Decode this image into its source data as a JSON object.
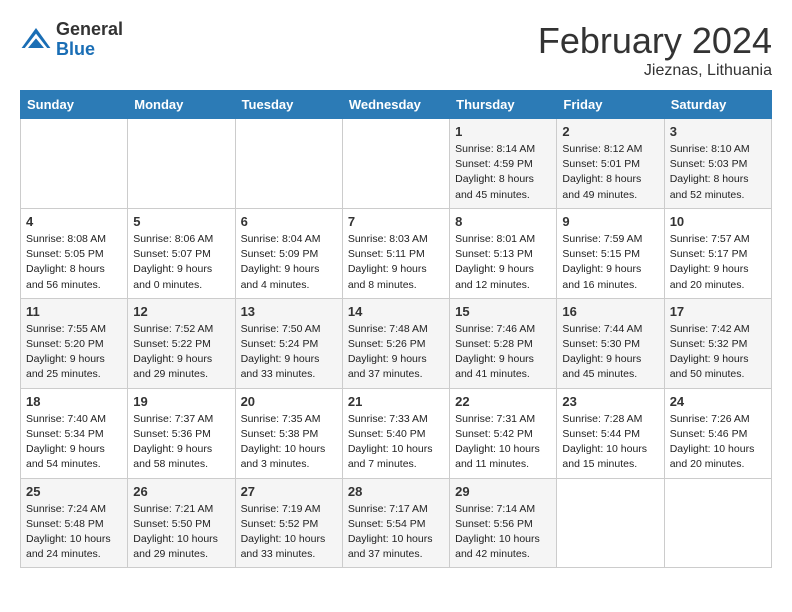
{
  "header": {
    "logo_general": "General",
    "logo_blue": "Blue",
    "month_title": "February 2024",
    "location": "Jieznas, Lithuania"
  },
  "weekdays": [
    "Sunday",
    "Monday",
    "Tuesday",
    "Wednesday",
    "Thursday",
    "Friday",
    "Saturday"
  ],
  "weeks": [
    [
      {
        "day": "",
        "info": ""
      },
      {
        "day": "",
        "info": ""
      },
      {
        "day": "",
        "info": ""
      },
      {
        "day": "",
        "info": ""
      },
      {
        "day": "1",
        "info": "Sunrise: 8:14 AM\nSunset: 4:59 PM\nDaylight: 8 hours\nand 45 minutes."
      },
      {
        "day": "2",
        "info": "Sunrise: 8:12 AM\nSunset: 5:01 PM\nDaylight: 8 hours\nand 49 minutes."
      },
      {
        "day": "3",
        "info": "Sunrise: 8:10 AM\nSunset: 5:03 PM\nDaylight: 8 hours\nand 52 minutes."
      }
    ],
    [
      {
        "day": "4",
        "info": "Sunrise: 8:08 AM\nSunset: 5:05 PM\nDaylight: 8 hours\nand 56 minutes."
      },
      {
        "day": "5",
        "info": "Sunrise: 8:06 AM\nSunset: 5:07 PM\nDaylight: 9 hours\nand 0 minutes."
      },
      {
        "day": "6",
        "info": "Sunrise: 8:04 AM\nSunset: 5:09 PM\nDaylight: 9 hours\nand 4 minutes."
      },
      {
        "day": "7",
        "info": "Sunrise: 8:03 AM\nSunset: 5:11 PM\nDaylight: 9 hours\nand 8 minutes."
      },
      {
        "day": "8",
        "info": "Sunrise: 8:01 AM\nSunset: 5:13 PM\nDaylight: 9 hours\nand 12 minutes."
      },
      {
        "day": "9",
        "info": "Sunrise: 7:59 AM\nSunset: 5:15 PM\nDaylight: 9 hours\nand 16 minutes."
      },
      {
        "day": "10",
        "info": "Sunrise: 7:57 AM\nSunset: 5:17 PM\nDaylight: 9 hours\nand 20 minutes."
      }
    ],
    [
      {
        "day": "11",
        "info": "Sunrise: 7:55 AM\nSunset: 5:20 PM\nDaylight: 9 hours\nand 25 minutes."
      },
      {
        "day": "12",
        "info": "Sunrise: 7:52 AM\nSunset: 5:22 PM\nDaylight: 9 hours\nand 29 minutes."
      },
      {
        "day": "13",
        "info": "Sunrise: 7:50 AM\nSunset: 5:24 PM\nDaylight: 9 hours\nand 33 minutes."
      },
      {
        "day": "14",
        "info": "Sunrise: 7:48 AM\nSunset: 5:26 PM\nDaylight: 9 hours\nand 37 minutes."
      },
      {
        "day": "15",
        "info": "Sunrise: 7:46 AM\nSunset: 5:28 PM\nDaylight: 9 hours\nand 41 minutes."
      },
      {
        "day": "16",
        "info": "Sunrise: 7:44 AM\nSunset: 5:30 PM\nDaylight: 9 hours\nand 45 minutes."
      },
      {
        "day": "17",
        "info": "Sunrise: 7:42 AM\nSunset: 5:32 PM\nDaylight: 9 hours\nand 50 minutes."
      }
    ],
    [
      {
        "day": "18",
        "info": "Sunrise: 7:40 AM\nSunset: 5:34 PM\nDaylight: 9 hours\nand 54 minutes."
      },
      {
        "day": "19",
        "info": "Sunrise: 7:37 AM\nSunset: 5:36 PM\nDaylight: 9 hours\nand 58 minutes."
      },
      {
        "day": "20",
        "info": "Sunrise: 7:35 AM\nSunset: 5:38 PM\nDaylight: 10 hours\nand 3 minutes."
      },
      {
        "day": "21",
        "info": "Sunrise: 7:33 AM\nSunset: 5:40 PM\nDaylight: 10 hours\nand 7 minutes."
      },
      {
        "day": "22",
        "info": "Sunrise: 7:31 AM\nSunset: 5:42 PM\nDaylight: 10 hours\nand 11 minutes."
      },
      {
        "day": "23",
        "info": "Sunrise: 7:28 AM\nSunset: 5:44 PM\nDaylight: 10 hours\nand 15 minutes."
      },
      {
        "day": "24",
        "info": "Sunrise: 7:26 AM\nSunset: 5:46 PM\nDaylight: 10 hours\nand 20 minutes."
      }
    ],
    [
      {
        "day": "25",
        "info": "Sunrise: 7:24 AM\nSunset: 5:48 PM\nDaylight: 10 hours\nand 24 minutes."
      },
      {
        "day": "26",
        "info": "Sunrise: 7:21 AM\nSunset: 5:50 PM\nDaylight: 10 hours\nand 29 minutes."
      },
      {
        "day": "27",
        "info": "Sunrise: 7:19 AM\nSunset: 5:52 PM\nDaylight: 10 hours\nand 33 minutes."
      },
      {
        "day": "28",
        "info": "Sunrise: 7:17 AM\nSunset: 5:54 PM\nDaylight: 10 hours\nand 37 minutes."
      },
      {
        "day": "29",
        "info": "Sunrise: 7:14 AM\nSunset: 5:56 PM\nDaylight: 10 hours\nand 42 minutes."
      },
      {
        "day": "",
        "info": ""
      },
      {
        "day": "",
        "info": ""
      }
    ]
  ]
}
